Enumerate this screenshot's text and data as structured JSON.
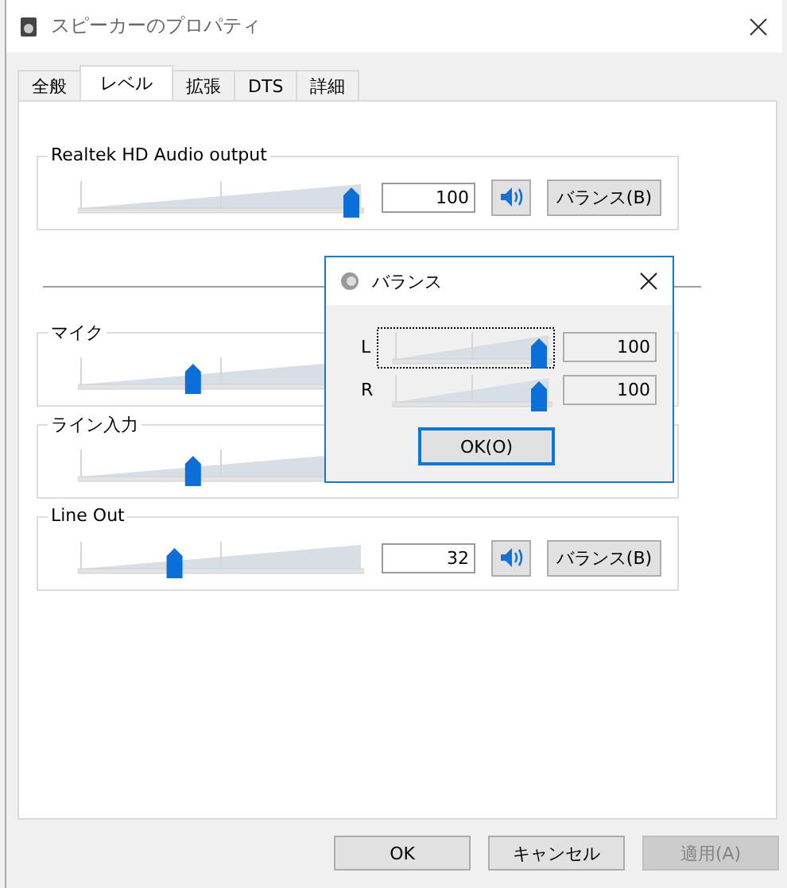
{
  "window": {
    "title": "スピーカーのプロパティ"
  },
  "tabs": [
    {
      "label": "全般",
      "selected": false
    },
    {
      "label": "レベル",
      "selected": true
    },
    {
      "label": "拡張",
      "selected": false
    },
    {
      "label": "DTS",
      "selected": false
    },
    {
      "label": "詳細",
      "selected": false
    }
  ],
  "levels": [
    {
      "name": "Realtek HD Audio output",
      "level": 1,
      "reading": "100",
      "muted": false,
      "balance_button": "バランス(B)"
    },
    {
      "name": "マイク",
      "level": 0.4
    },
    {
      "name": "ライン入力",
      "level": 0.4
    },
    {
      "name": "Line Out",
      "level": 0.33,
      "reading": "32",
      "muted": false,
      "balance_button": "バランス(B)"
    }
  ],
  "balance_dialog": {
    "title": "バランス",
    "channels": [
      {
        "label": "L",
        "level": 1,
        "reading": "100",
        "focused": true
      },
      {
        "label": "R",
        "level": 1,
        "reading": "100",
        "focused": false
      }
    ],
    "ok_button": {
      "label": "OK(O)"
    }
  },
  "buttons": [
    {
      "label": "OK",
      "disabled": false
    },
    {
      "label": "キャンセル",
      "disabled": false
    },
    {
      "label": "適用(A)",
      "disabled": true
    }
  ]
}
